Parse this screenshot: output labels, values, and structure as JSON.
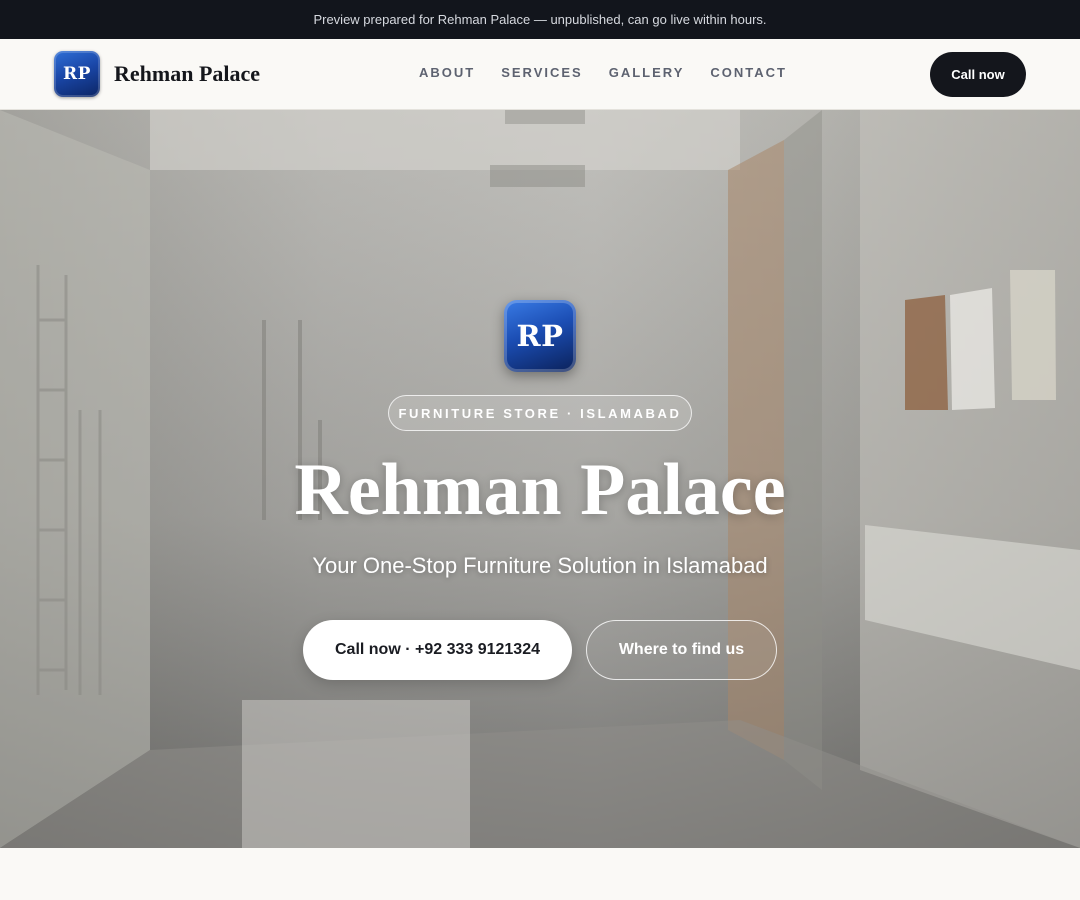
{
  "banner": {
    "text": "Preview prepared for Rehman Palace — unpublished, can go live within hours."
  },
  "nav": {
    "logo_initials": "RP",
    "brand": "Rehman Palace",
    "links": [
      {
        "label": "ABOUT"
      },
      {
        "label": "SERVICES"
      },
      {
        "label": "GALLERY"
      },
      {
        "label": "CONTACT"
      }
    ],
    "cta_label": "Call now"
  },
  "hero": {
    "logo_initials": "RP",
    "eyebrow": "FURNITURE STORE · ISLAMABAD",
    "title": "Rehman Palace",
    "subtitle": "Your One-Stop Furniture Solution in Islamabad",
    "primary_button": "Call now · +92 333 9121324",
    "secondary_button": "Where to find us",
    "background_image": "store-interior-photo"
  },
  "colors": {
    "dark": "#12151c",
    "accent_blue": "#1a47a8",
    "page_bg": "#faf9f6"
  }
}
